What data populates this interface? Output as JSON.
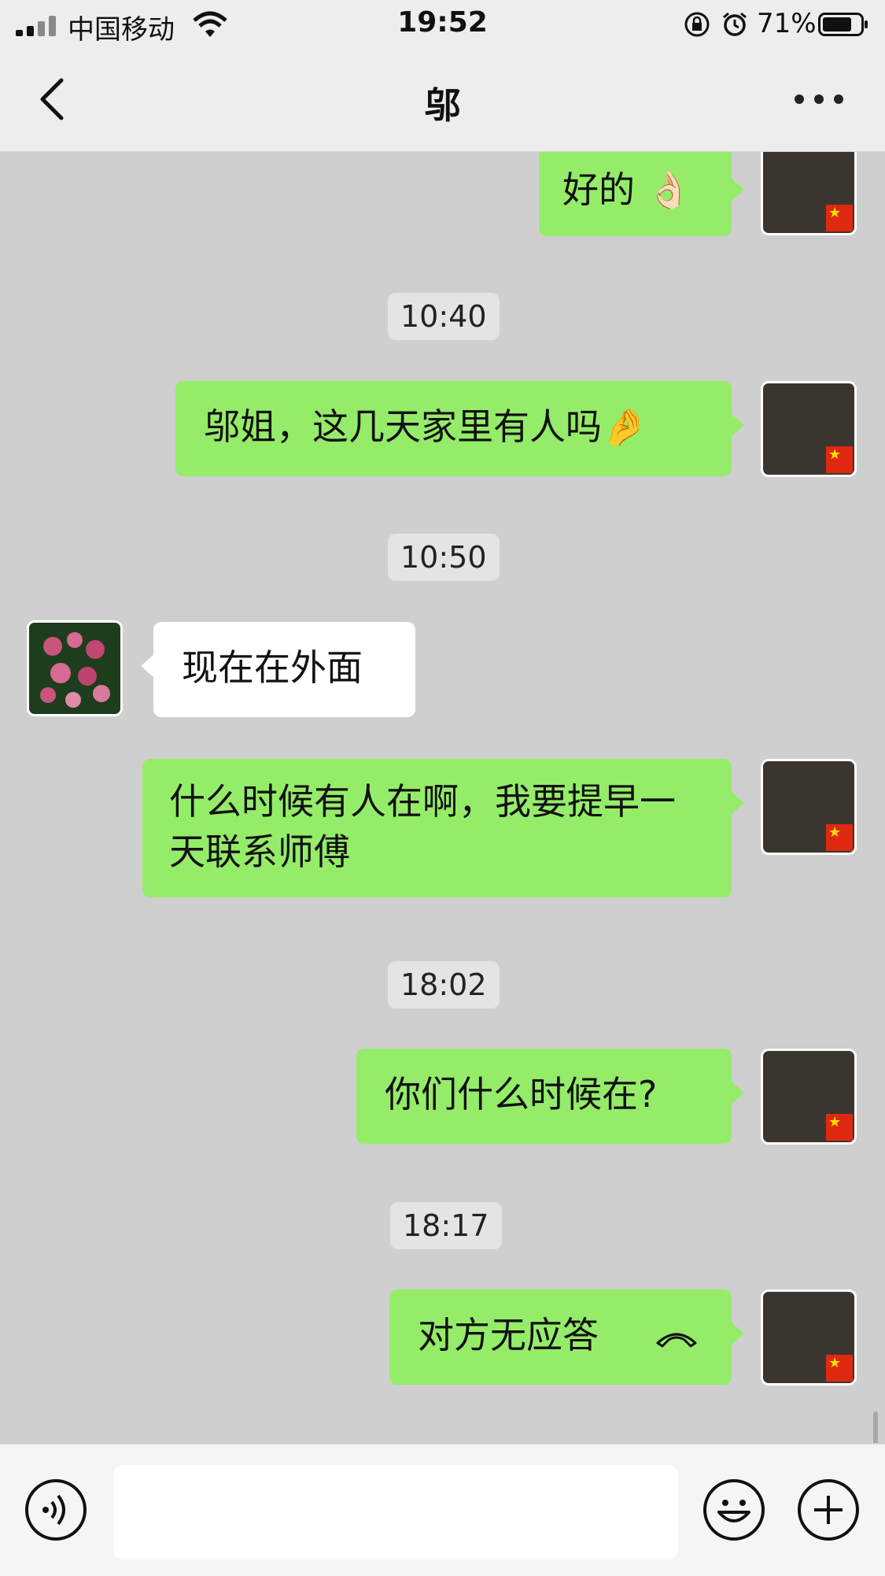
{
  "status": {
    "carrier": "中国移动",
    "time": "19:52",
    "battery_pct": "71%"
  },
  "header": {
    "title": "邬"
  },
  "messages": [
    {
      "from": "me",
      "text": "好的 👌🏻"
    },
    {
      "time": "10:40"
    },
    {
      "from": "me",
      "text": "邬姐，这几天家里有人吗🤌"
    },
    {
      "time": "10:50"
    },
    {
      "from": "other",
      "text": "现在在外面"
    },
    {
      "from": "me",
      "text": "什么时候有人在啊，我要提早一天联系师傅"
    },
    {
      "time": "18:02"
    },
    {
      "from": "me",
      "text": "你们什么时候在?"
    },
    {
      "time": "18:17"
    },
    {
      "from": "me",
      "text": "对方无应答",
      "icon": "hang-up-phone-icon"
    }
  ],
  "colors": {
    "my_bubble": "#95ec69",
    "their_bubble": "#ffffff",
    "chat_background": "#cfcfcf",
    "bar_background": "#ededed"
  }
}
